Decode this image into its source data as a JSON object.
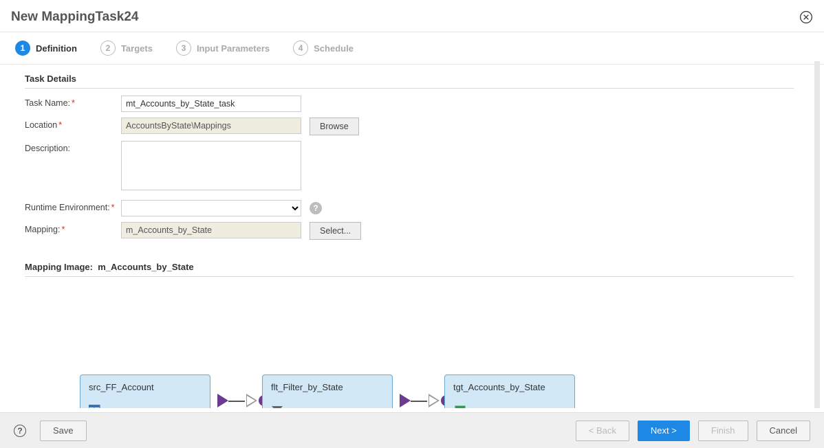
{
  "header": {
    "title": "New MappingTask24"
  },
  "steps": [
    {
      "num": "1",
      "label": "Definition"
    },
    {
      "num": "2",
      "label": "Targets"
    },
    {
      "num": "3",
      "label": "Input Parameters"
    },
    {
      "num": "4",
      "label": "Schedule"
    }
  ],
  "section": {
    "task_details": "Task Details",
    "mapping_image_label": "Mapping Image:",
    "mapping_image_name": "m_Accounts_by_State"
  },
  "form": {
    "task_name": {
      "label": "Task Name:",
      "value": "mt_Accounts_by_State_task"
    },
    "location": {
      "label": "Location",
      "value": "AccountsByState\\Mappings",
      "button": "Browse"
    },
    "description": {
      "label": "Description:",
      "value": ""
    },
    "runtime": {
      "label": "Runtime Environment:",
      "value": ""
    },
    "mapping": {
      "label": "Mapping:",
      "value": "m_Accounts_by_State",
      "button": "Select..."
    }
  },
  "mapping_nodes": [
    {
      "name": "src_FF_Account",
      "icon": "source"
    },
    {
      "name": "flt_Filter_by_State",
      "icon": "filter"
    },
    {
      "name": "tgt_Accounts_by_State",
      "icon": "target"
    }
  ],
  "footer": {
    "save": "Save",
    "back": "< Back",
    "next": "Next >",
    "finish": "Finish",
    "cancel": "Cancel"
  }
}
